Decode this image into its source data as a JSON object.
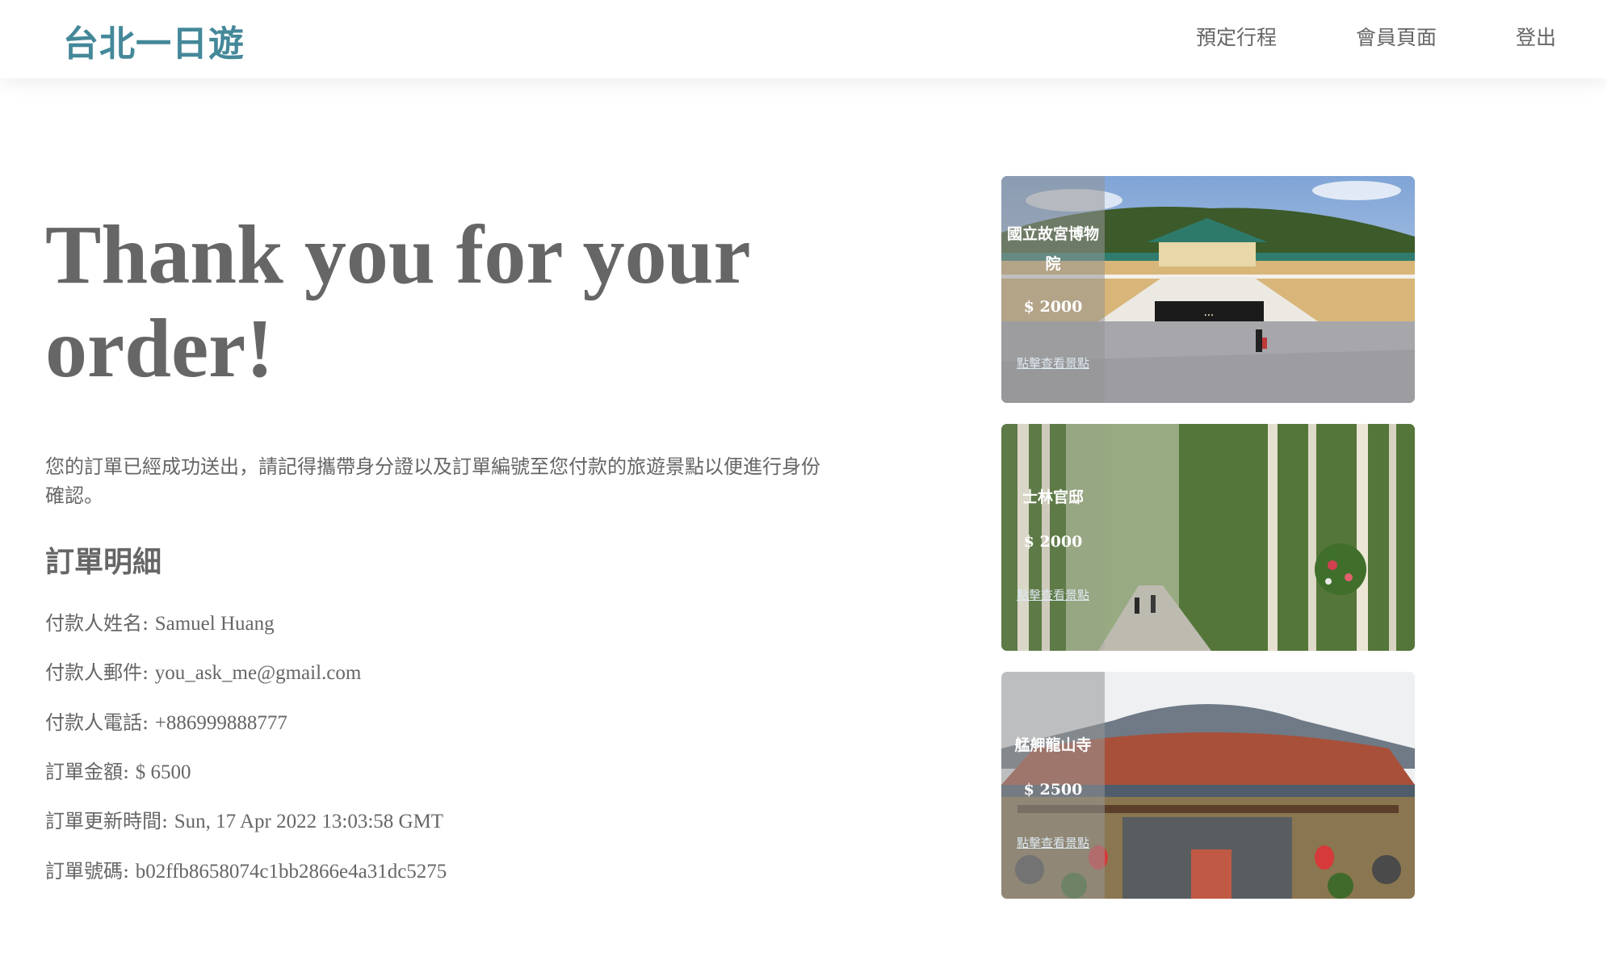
{
  "header": {
    "brand": "台北一日遊",
    "nav": [
      "預定行程",
      "會員頁面",
      "登出"
    ]
  },
  "main": {
    "headline_line1": "Thank you for your",
    "headline_line2": "order!",
    "notice": "您的訂單已經成功送出，請記得攜帶身分證以及訂單編號至您付款的旅遊景點以便進行身份確認。",
    "details_title": "訂單明細",
    "details": [
      {
        "label": "付款人姓名: ",
        "value": "Samuel Huang"
      },
      {
        "label": "付款人郵件: ",
        "value": "you_ask_me@gmail.com"
      },
      {
        "label": "付款人電話: ",
        "value": "+886999888777"
      },
      {
        "label": "訂單金額: ",
        "value": "$ 6500"
      },
      {
        "label": "訂單更新時間: ",
        "value": "Sun, 17 Apr 2022 13:03:58 GMT"
      },
      {
        "label": "訂單號碼: ",
        "value": "b02ffb8658074c1bb2866e4a31dc5275"
      }
    ]
  },
  "attractions": [
    {
      "name": "國立故宮博物院",
      "price": "$ 2000",
      "link": "點擊查看景點"
    },
    {
      "name": "士林官邸",
      "price": "$ 2000",
      "link": "點擊查看景點"
    },
    {
      "name": "艋舺龍山寺",
      "price": "$ 2500",
      "link": "點擊查看景點"
    }
  ]
}
